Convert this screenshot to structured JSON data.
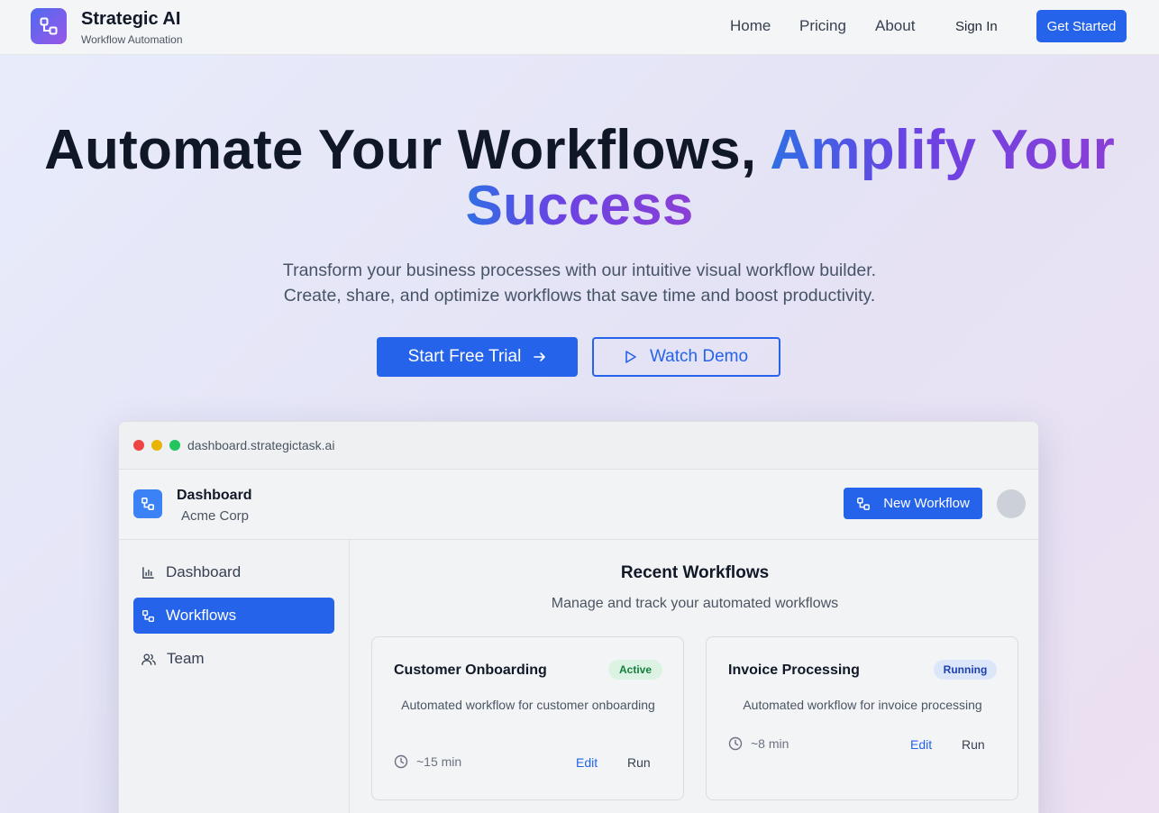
{
  "header": {
    "brand_name": "Strategic AI",
    "brand_tagline": "Workflow Automation",
    "logo_icon": "workflow-icon",
    "nav": [
      "Home",
      "Pricing",
      "About"
    ],
    "signin_label": "Sign In",
    "cta_label": "Get Started"
  },
  "hero": {
    "title_part1": "Automate Your Workflows, ",
    "title_part2": "Amplify Your",
    "title_part3": "Success",
    "subtitle_line1": "Transform your business processes with our intuitive visual workflow builder.",
    "subtitle_line2": "Create, share, and optimize workflows that save time and boost productivity.",
    "primary_cta": "Start Free Trial",
    "secondary_cta": "Watch Demo"
  },
  "dashboard": {
    "url": "dashboard.strategictask.ai",
    "title": "Dashboard",
    "org": "Acme Corp",
    "new_workflow_label": "New Workflow",
    "sidebar": [
      {
        "label": "Dashboard",
        "icon": "bar-chart-icon",
        "active": false
      },
      {
        "label": "Workflows",
        "icon": "workflow-icon",
        "active": true
      },
      {
        "label": "Team",
        "icon": "users-icon",
        "active": false
      }
    ],
    "main_title": "Recent Workflows",
    "main_subtitle": "Manage and track your automated workflows",
    "cards": [
      {
        "title": "Customer Onboarding",
        "status": "Active",
        "description": "Automated workflow for customer onboarding",
        "duration": "~15 min",
        "edit_label": "Edit",
        "run_label": "Run"
      },
      {
        "title": "Invoice Processing",
        "status": "Running",
        "description": "Automated workflow for invoice processing",
        "duration": "~8 min",
        "edit_label": "Edit",
        "run_label": "Run"
      }
    ]
  },
  "colors": {
    "primary": "#2563eb",
    "active_badge_bg": "#dcf3e3",
    "active_badge_text": "#15803d",
    "running_badge_bg": "#dbe6fb",
    "running_badge_text": "#1e40af",
    "dot_red": "#ef4444",
    "dot_yellow": "#eab308",
    "dot_green": "#22c55e"
  }
}
